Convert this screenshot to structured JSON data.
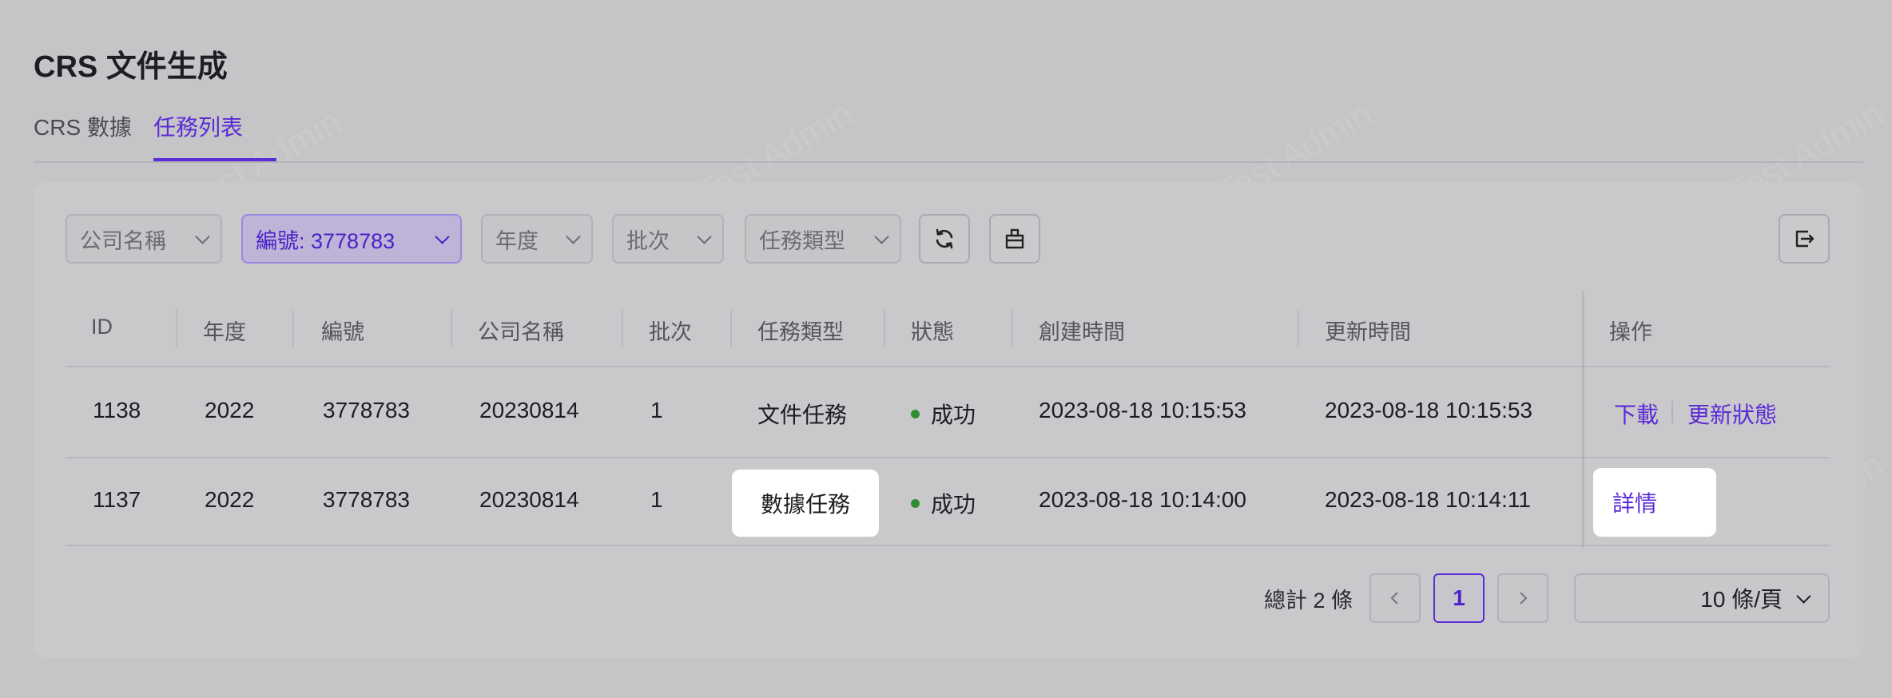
{
  "page": {
    "title": "CRS 文件生成"
  },
  "tabs": [
    {
      "label": "CRS 數據",
      "active": false
    },
    {
      "label": "任務列表",
      "active": true
    }
  ],
  "filters": {
    "company_name": {
      "label": "公司名稱"
    },
    "number": {
      "label": "編號: 3778783",
      "selected": true
    },
    "year": {
      "label": "年度"
    },
    "batch": {
      "label": "批次"
    },
    "task_type": {
      "label": "任務類型"
    }
  },
  "toolbar": {
    "refresh_icon": "refresh-icon",
    "clear_icon": "clear-icon",
    "export_icon": "export-icon"
  },
  "table": {
    "columns": [
      "ID",
      "年度",
      "編號",
      "公司名稱",
      "批次",
      "任務類型",
      "狀態",
      "創建時間",
      "更新時間",
      "操作"
    ],
    "rows": [
      {
        "id": "1138",
        "year": "2022",
        "number": "3778783",
        "company": "20230814",
        "batch": "1",
        "task_type": "文件任務",
        "status": "成功",
        "created": "2023-08-18 10:15:53",
        "updated": "2023-08-18 10:15:53",
        "actions": [
          "下載",
          "更新狀態"
        ]
      },
      {
        "id": "1137",
        "year": "2022",
        "number": "3778783",
        "company": "20230814",
        "batch": "1",
        "task_type": "數據任務",
        "status": "成功",
        "created": "2023-08-18 10:14:00",
        "updated": "2023-08-18 10:14:11",
        "actions": [
          "詳情"
        ]
      }
    ]
  },
  "pagination": {
    "total": "總計 2 條",
    "current_page": "1",
    "page_size": "10 條/頁"
  },
  "watermark": {
    "text": "LongPort Test Admin"
  },
  "colors": {
    "accent": "#5b2bd6",
    "success": "#2f8d2f",
    "background": "#c5c5c8"
  }
}
